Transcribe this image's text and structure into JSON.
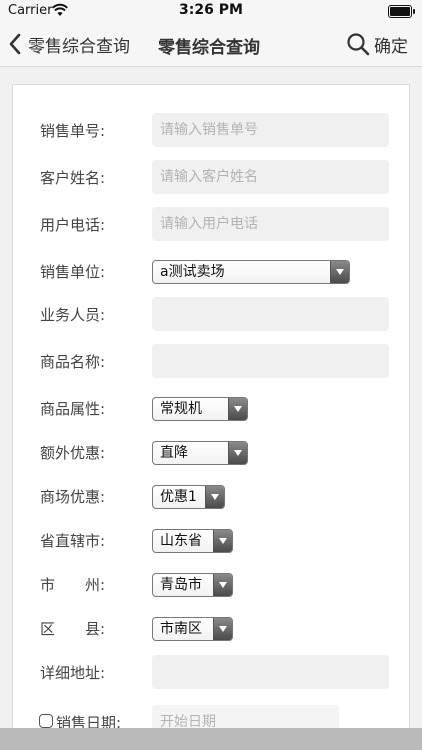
{
  "status": {
    "carrier": "Carrier",
    "time": "3:26 PM"
  },
  "nav": {
    "back_label": "零售综合查询",
    "title": "零售综合查询",
    "confirm_label": "确定"
  },
  "form": {
    "sales_no": {
      "label": "销售单号:",
      "placeholder": "请输入销售单号"
    },
    "customer_name": {
      "label": "客户姓名:",
      "placeholder": "请输入客户姓名"
    },
    "user_phone": {
      "label": "用户电话:",
      "placeholder": "请输入用户电话"
    },
    "sales_unit": {
      "label": "销售单位:",
      "value": "a测试卖场"
    },
    "salesperson": {
      "label": "业务人员:",
      "value": ""
    },
    "product_name": {
      "label": "商品名称:",
      "value": ""
    },
    "product_attr": {
      "label": "商品属性:",
      "value": "常规机"
    },
    "extra_discount": {
      "label": "额外优惠:",
      "value": "直降"
    },
    "mall_discount": {
      "label": "商场优惠:",
      "value": "优惠1"
    },
    "province": {
      "label": "省直辖市:",
      "value": "山东省"
    },
    "city": {
      "label": "市　　州:",
      "value": "青岛市"
    },
    "county": {
      "label": "区　　县:",
      "value": "市南区"
    },
    "address": {
      "label": "详细地址:",
      "value": ""
    },
    "sales_date": {
      "label": "销售日期:",
      "placeholder": "开始日期",
      "checked": false
    }
  }
}
